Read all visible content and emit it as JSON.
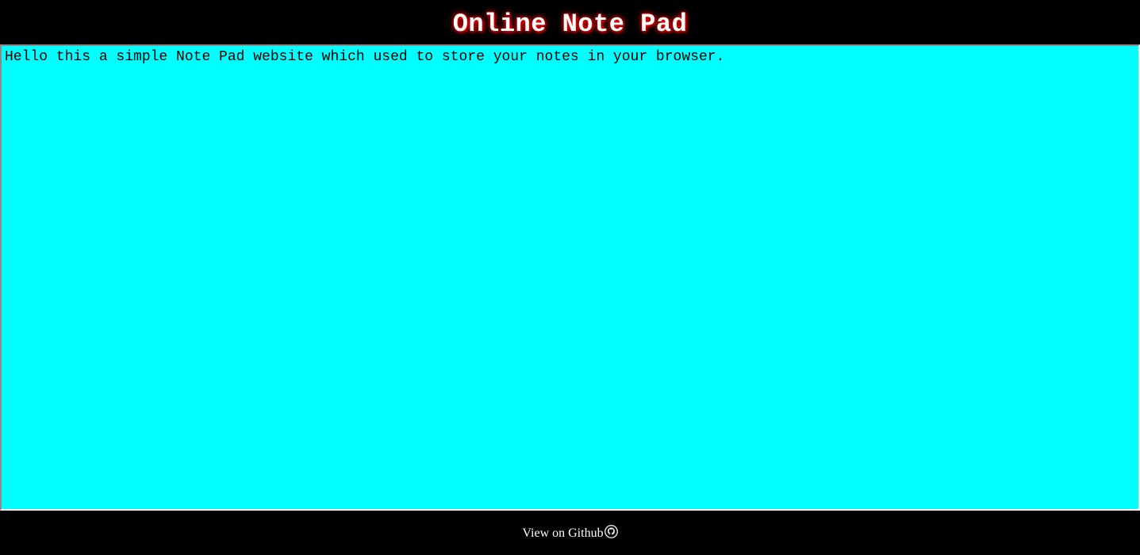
{
  "header": {
    "title": "Online Note Pad"
  },
  "editor": {
    "content": "Hello this a simple Note Pad website which used to store your notes in your browser."
  },
  "footer": {
    "link_label": "View on Github",
    "link_icon": "github-icon"
  },
  "colors": {
    "background": "#000000",
    "editor_background": "#00ffff",
    "title_text": "#ffffff",
    "title_glow": "#ff0000"
  }
}
